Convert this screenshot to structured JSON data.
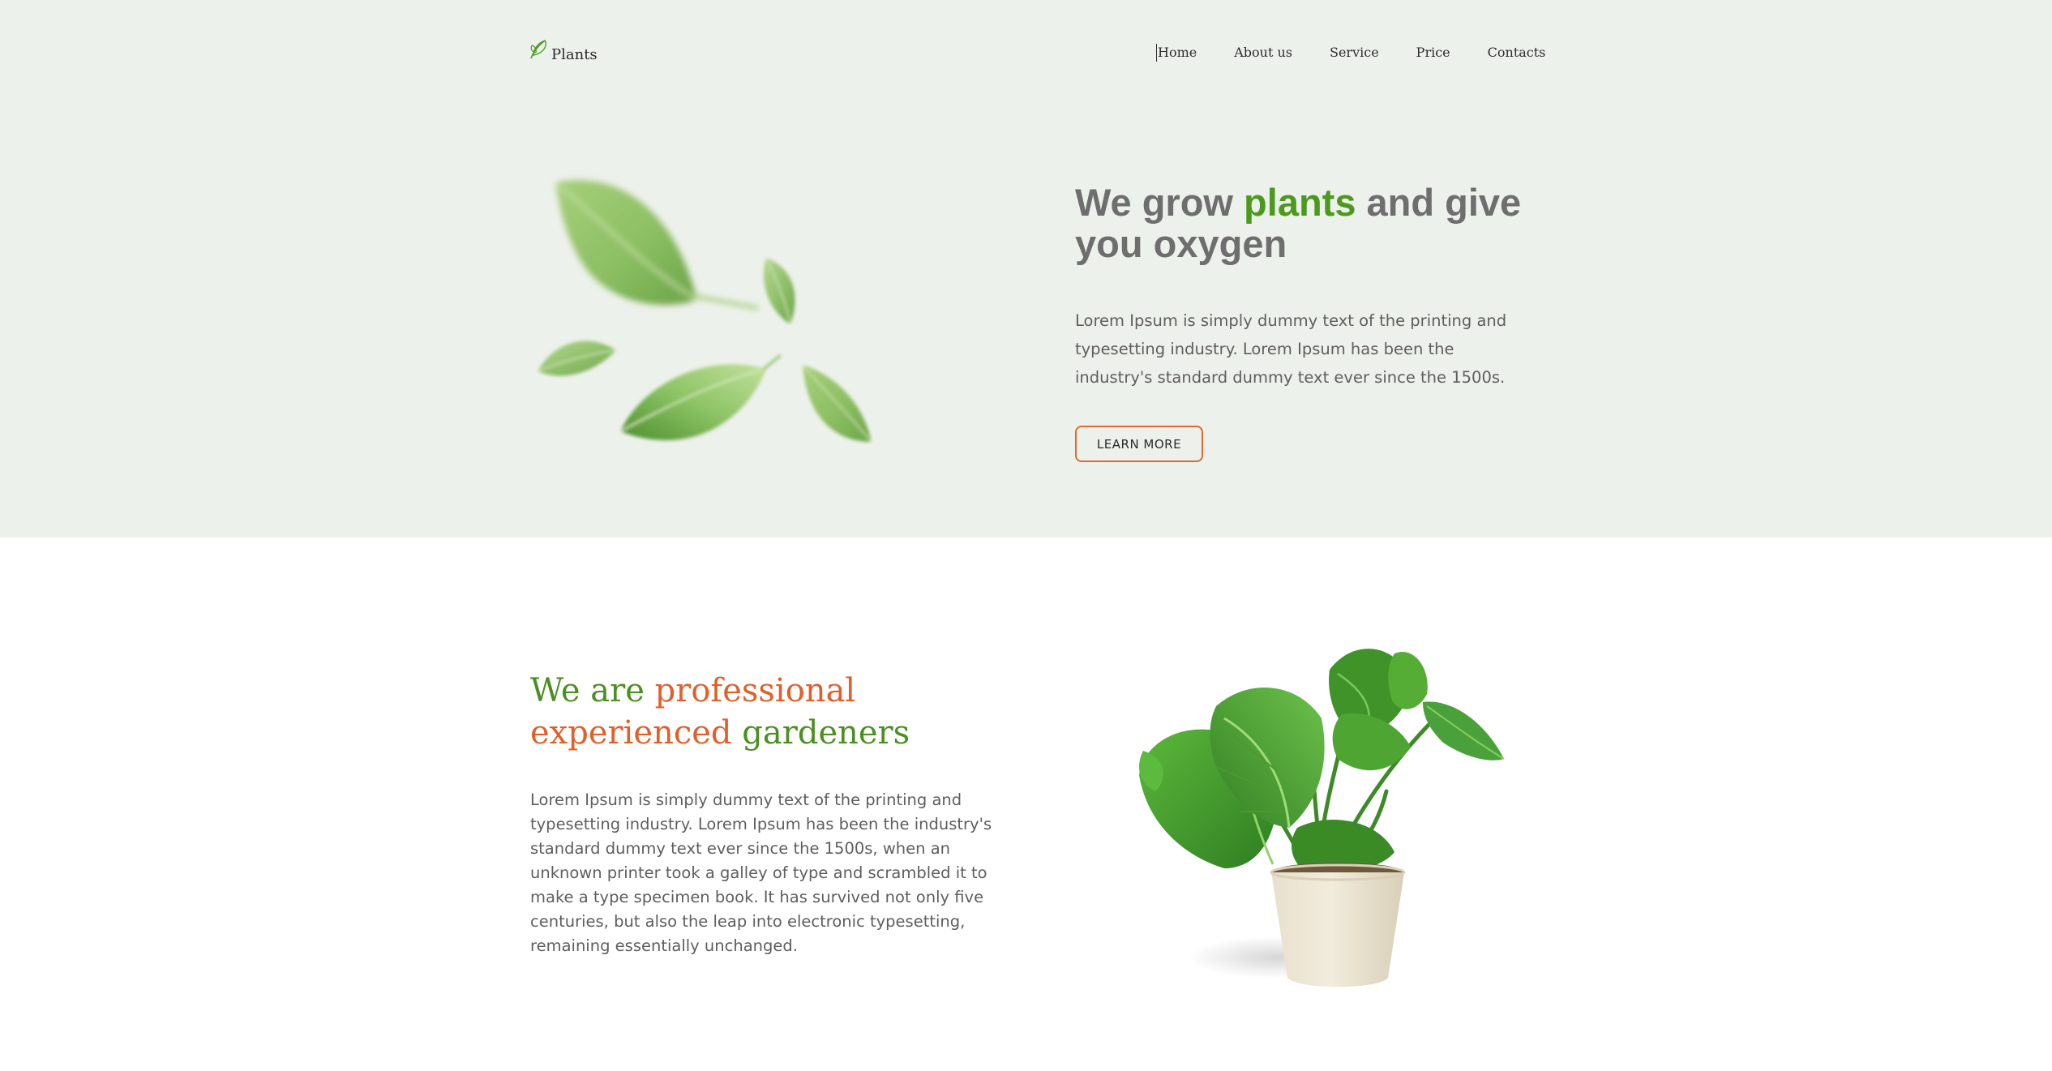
{
  "brand": {
    "logo_text": "Plants"
  },
  "nav": {
    "items": [
      {
        "label": "Home"
      },
      {
        "label": "About us"
      },
      {
        "label": "Service"
      },
      {
        "label": "Price"
      },
      {
        "label": "Contacts"
      }
    ]
  },
  "hero": {
    "title_part1": "We grow ",
    "title_accent": "plants",
    "title_part2": " and give you oxygen",
    "description": "Lorem Ipsum is simply dummy text of the printing and typesetting industry. Lorem Ipsum has been the industry's standard dummy text ever since the 1500s.",
    "button_label": "LEARN MORE"
  },
  "about": {
    "title_part1": "We are ",
    "title_orange": "professional experienced",
    "title_part2": " gardeners",
    "description": "Lorem Ipsum is simply dummy text of the printing and typesetting industry. Lorem Ipsum has been the industry's standard dummy text ever since the 1500s, when an unknown printer took a galley of type and scrambled it to make a type specimen book. It has survived not only five centuries, but also the leap into electronic typesetting, remaining essentially unchanged."
  },
  "colors": {
    "hero_background": "#edf1eb",
    "accent_green": "#4b9a1e",
    "accent_orange": "#e0602b",
    "button_border": "#db6a33"
  },
  "icons": {
    "logo": "leaf-icon",
    "hero_image": "falling-leaves-illustration",
    "about_image": "potted-monstera-plant"
  }
}
